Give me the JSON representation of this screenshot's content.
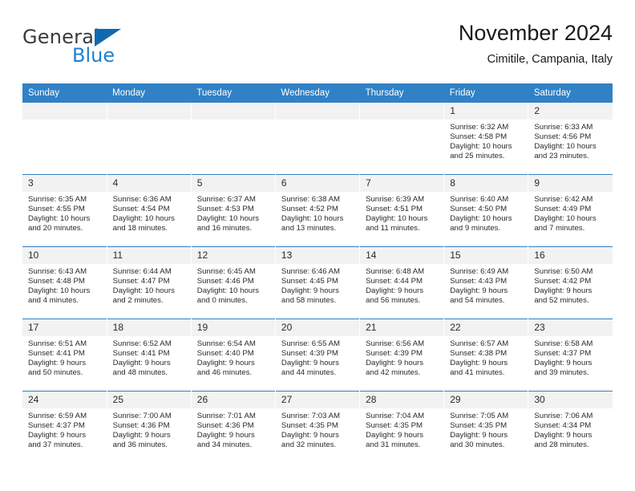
{
  "brand": {
    "name_part1": "General",
    "name_part2": "Blue"
  },
  "header": {
    "title": "November 2024",
    "subtitle": "Cimitile, Campania, Italy"
  },
  "colors": {
    "header_blue": "#3081c5",
    "logo_blue": "#1f80d0",
    "daynum_band": "#f2f2f2"
  },
  "weekdays": [
    "Sunday",
    "Monday",
    "Tuesday",
    "Wednesday",
    "Thursday",
    "Friday",
    "Saturday"
  ],
  "labels": {
    "sunrise_prefix": "Sunrise:",
    "sunset_prefix": "Sunset:",
    "daylight_prefix": "Daylight:"
  },
  "weeks": [
    [
      {
        "day": "",
        "blank": true
      },
      {
        "day": "",
        "blank": true
      },
      {
        "day": "",
        "blank": true
      },
      {
        "day": "",
        "blank": true
      },
      {
        "day": "",
        "blank": true
      },
      {
        "day": "1",
        "sunrise": "Sunrise: 6:32 AM",
        "sunset": "Sunset: 4:58 PM",
        "daylight_1": "Daylight: 10 hours",
        "daylight_2": "and 25 minutes."
      },
      {
        "day": "2",
        "sunrise": "Sunrise: 6:33 AM",
        "sunset": "Sunset: 4:56 PM",
        "daylight_1": "Daylight: 10 hours",
        "daylight_2": "and 23 minutes."
      }
    ],
    [
      {
        "day": "3",
        "sunrise": "Sunrise: 6:35 AM",
        "sunset": "Sunset: 4:55 PM",
        "daylight_1": "Daylight: 10 hours",
        "daylight_2": "and 20 minutes."
      },
      {
        "day": "4",
        "sunrise": "Sunrise: 6:36 AM",
        "sunset": "Sunset: 4:54 PM",
        "daylight_1": "Daylight: 10 hours",
        "daylight_2": "and 18 minutes."
      },
      {
        "day": "5",
        "sunrise": "Sunrise: 6:37 AM",
        "sunset": "Sunset: 4:53 PM",
        "daylight_1": "Daylight: 10 hours",
        "daylight_2": "and 16 minutes."
      },
      {
        "day": "6",
        "sunrise": "Sunrise: 6:38 AM",
        "sunset": "Sunset: 4:52 PM",
        "daylight_1": "Daylight: 10 hours",
        "daylight_2": "and 13 minutes."
      },
      {
        "day": "7",
        "sunrise": "Sunrise: 6:39 AM",
        "sunset": "Sunset: 4:51 PM",
        "daylight_1": "Daylight: 10 hours",
        "daylight_2": "and 11 minutes."
      },
      {
        "day": "8",
        "sunrise": "Sunrise: 6:40 AM",
        "sunset": "Sunset: 4:50 PM",
        "daylight_1": "Daylight: 10 hours",
        "daylight_2": "and 9 minutes."
      },
      {
        "day": "9",
        "sunrise": "Sunrise: 6:42 AM",
        "sunset": "Sunset: 4:49 PM",
        "daylight_1": "Daylight: 10 hours",
        "daylight_2": "and 7 minutes."
      }
    ],
    [
      {
        "day": "10",
        "sunrise": "Sunrise: 6:43 AM",
        "sunset": "Sunset: 4:48 PM",
        "daylight_1": "Daylight: 10 hours",
        "daylight_2": "and 4 minutes."
      },
      {
        "day": "11",
        "sunrise": "Sunrise: 6:44 AM",
        "sunset": "Sunset: 4:47 PM",
        "daylight_1": "Daylight: 10 hours",
        "daylight_2": "and 2 minutes."
      },
      {
        "day": "12",
        "sunrise": "Sunrise: 6:45 AM",
        "sunset": "Sunset: 4:46 PM",
        "daylight_1": "Daylight: 10 hours",
        "daylight_2": "and 0 minutes."
      },
      {
        "day": "13",
        "sunrise": "Sunrise: 6:46 AM",
        "sunset": "Sunset: 4:45 PM",
        "daylight_1": "Daylight: 9 hours",
        "daylight_2": "and 58 minutes."
      },
      {
        "day": "14",
        "sunrise": "Sunrise: 6:48 AM",
        "sunset": "Sunset: 4:44 PM",
        "daylight_1": "Daylight: 9 hours",
        "daylight_2": "and 56 minutes."
      },
      {
        "day": "15",
        "sunrise": "Sunrise: 6:49 AM",
        "sunset": "Sunset: 4:43 PM",
        "daylight_1": "Daylight: 9 hours",
        "daylight_2": "and 54 minutes."
      },
      {
        "day": "16",
        "sunrise": "Sunrise: 6:50 AM",
        "sunset": "Sunset: 4:42 PM",
        "daylight_1": "Daylight: 9 hours",
        "daylight_2": "and 52 minutes."
      }
    ],
    [
      {
        "day": "17",
        "sunrise": "Sunrise: 6:51 AM",
        "sunset": "Sunset: 4:41 PM",
        "daylight_1": "Daylight: 9 hours",
        "daylight_2": "and 50 minutes."
      },
      {
        "day": "18",
        "sunrise": "Sunrise: 6:52 AM",
        "sunset": "Sunset: 4:41 PM",
        "daylight_1": "Daylight: 9 hours",
        "daylight_2": "and 48 minutes."
      },
      {
        "day": "19",
        "sunrise": "Sunrise: 6:54 AM",
        "sunset": "Sunset: 4:40 PM",
        "daylight_1": "Daylight: 9 hours",
        "daylight_2": "and 46 minutes."
      },
      {
        "day": "20",
        "sunrise": "Sunrise: 6:55 AM",
        "sunset": "Sunset: 4:39 PM",
        "daylight_1": "Daylight: 9 hours",
        "daylight_2": "and 44 minutes."
      },
      {
        "day": "21",
        "sunrise": "Sunrise: 6:56 AM",
        "sunset": "Sunset: 4:39 PM",
        "daylight_1": "Daylight: 9 hours",
        "daylight_2": "and 42 minutes."
      },
      {
        "day": "22",
        "sunrise": "Sunrise: 6:57 AM",
        "sunset": "Sunset: 4:38 PM",
        "daylight_1": "Daylight: 9 hours",
        "daylight_2": "and 41 minutes."
      },
      {
        "day": "23",
        "sunrise": "Sunrise: 6:58 AM",
        "sunset": "Sunset: 4:37 PM",
        "daylight_1": "Daylight: 9 hours",
        "daylight_2": "and 39 minutes."
      }
    ],
    [
      {
        "day": "24",
        "sunrise": "Sunrise: 6:59 AM",
        "sunset": "Sunset: 4:37 PM",
        "daylight_1": "Daylight: 9 hours",
        "daylight_2": "and 37 minutes."
      },
      {
        "day": "25",
        "sunrise": "Sunrise: 7:00 AM",
        "sunset": "Sunset: 4:36 PM",
        "daylight_1": "Daylight: 9 hours",
        "daylight_2": "and 36 minutes."
      },
      {
        "day": "26",
        "sunrise": "Sunrise: 7:01 AM",
        "sunset": "Sunset: 4:36 PM",
        "daylight_1": "Daylight: 9 hours",
        "daylight_2": "and 34 minutes."
      },
      {
        "day": "27",
        "sunrise": "Sunrise: 7:03 AM",
        "sunset": "Sunset: 4:35 PM",
        "daylight_1": "Daylight: 9 hours",
        "daylight_2": "and 32 minutes."
      },
      {
        "day": "28",
        "sunrise": "Sunrise: 7:04 AM",
        "sunset": "Sunset: 4:35 PM",
        "daylight_1": "Daylight: 9 hours",
        "daylight_2": "and 31 minutes."
      },
      {
        "day": "29",
        "sunrise": "Sunrise: 7:05 AM",
        "sunset": "Sunset: 4:35 PM",
        "daylight_1": "Daylight: 9 hours",
        "daylight_2": "and 30 minutes."
      },
      {
        "day": "30",
        "sunrise": "Sunrise: 7:06 AM",
        "sunset": "Sunset: 4:34 PM",
        "daylight_1": "Daylight: 9 hours",
        "daylight_2": "and 28 minutes."
      }
    ]
  ]
}
